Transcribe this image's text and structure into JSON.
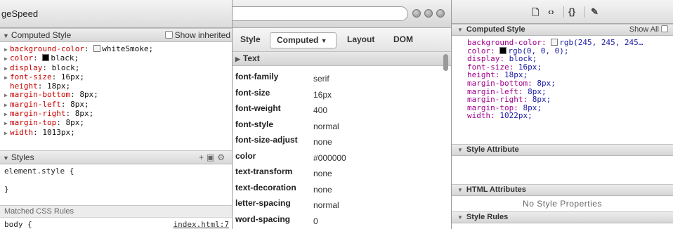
{
  "left_panel": {
    "title": "geSpeed",
    "computed_header": "Computed Style",
    "show_inherited": "Show inherited",
    "props": [
      {
        "name": "background-color",
        "value": "whiteSmoke;",
        "swatch": "#f5f5f5"
      },
      {
        "name": "color",
        "value": "black;",
        "swatch": "#000000"
      },
      {
        "name": "display",
        "value": "block;"
      },
      {
        "name": "font-size",
        "value": "16px;"
      },
      {
        "name": "height",
        "value": "18px;"
      },
      {
        "name": "margin-bottom",
        "value": "8px;"
      },
      {
        "name": "margin-left",
        "value": "8px;"
      },
      {
        "name": "margin-right",
        "value": "8px;"
      },
      {
        "name": "margin-top",
        "value": "8px;"
      },
      {
        "name": "width",
        "value": "1013px;"
      }
    ],
    "styles_header": "Styles",
    "element_style_open": "element.style {",
    "element_style_close": "}",
    "matched_header": "Matched CSS Rules",
    "body_rule": "body {",
    "body_link": "index.html:7"
  },
  "middle_panel": {
    "tabs": {
      "style": "Style",
      "computed": "Computed",
      "layout": "Layout",
      "dom": "DOM"
    },
    "section": "Text",
    "rows": [
      {
        "key": "font-family",
        "value": "serif"
      },
      {
        "key": "font-size",
        "value": "16px"
      },
      {
        "key": "font-weight",
        "value": "400"
      },
      {
        "key": "font-style",
        "value": "normal"
      },
      {
        "key": "font-size-adjust",
        "value": "none"
      },
      {
        "key": "color",
        "value": "#000000"
      },
      {
        "key": "text-transform",
        "value": "none"
      },
      {
        "key": "text-decoration",
        "value": "none"
      },
      {
        "key": "letter-spacing",
        "value": "normal"
      },
      {
        "key": "word-spacing",
        "value": "0"
      }
    ]
  },
  "right_panel": {
    "computed_header": "Computed Style",
    "show_all": "Show All",
    "props": [
      {
        "name": "background-color",
        "value": "rgb(245, 245, 245…",
        "swatch": "#f5f5f5"
      },
      {
        "name": "color",
        "value": "rgb(0, 0, 0);",
        "swatch": "#000000"
      },
      {
        "name": "display",
        "value": "block;"
      },
      {
        "name": "font-size",
        "value": "16px;"
      },
      {
        "name": "height",
        "value": "18px;"
      },
      {
        "name": "margin-bottom",
        "value": "8px;"
      },
      {
        "name": "margin-left",
        "value": "8px;"
      },
      {
        "name": "margin-right",
        "value": "8px;"
      },
      {
        "name": "margin-top",
        "value": "8px;"
      },
      {
        "name": "width",
        "value": "1022px;"
      }
    ],
    "style_attribute_header": "Style Attribute",
    "html_attributes_header": "HTML Attributes",
    "no_style_properties": "No Style Properties",
    "style_rules_header": "Style Rules"
  }
}
